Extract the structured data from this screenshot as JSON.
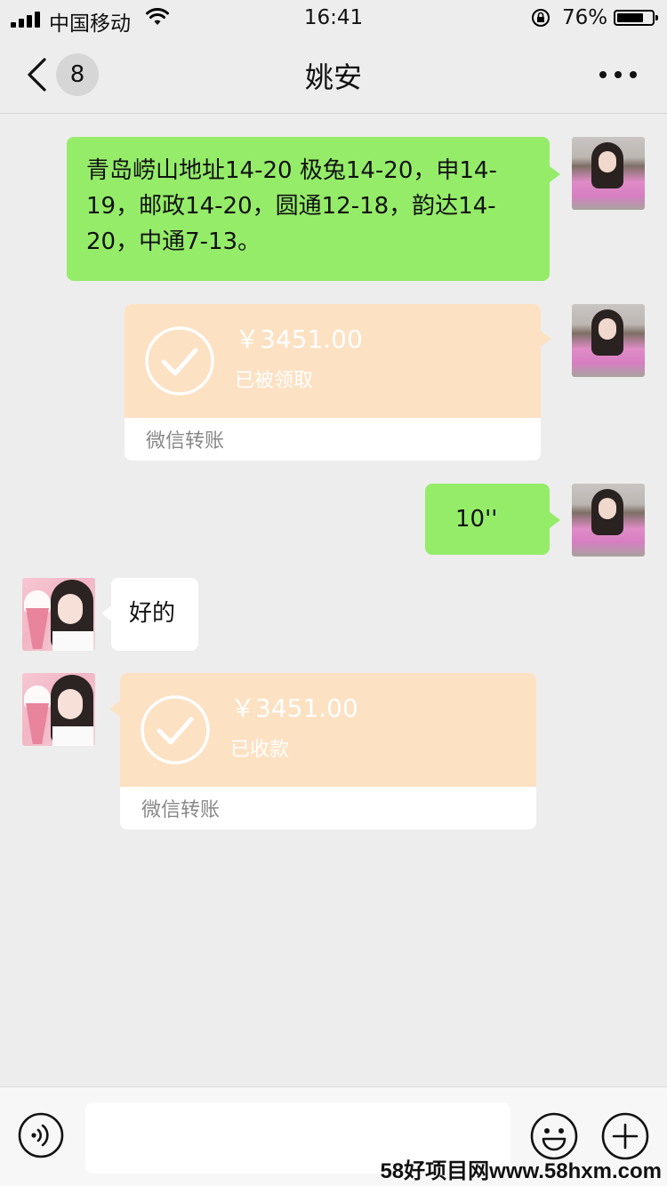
{
  "status_bar": {
    "carrier": "中国移动",
    "time": "16:41",
    "battery_percent": "76%",
    "battery_level": 0.76
  },
  "nav": {
    "unread_count": "8",
    "title": "姚安",
    "back_icon": "chevron-left-icon",
    "more_icon": "more-dots-icon"
  },
  "messages": [
    {
      "side": "self",
      "type": "text",
      "text": "青岛崂山地址14-20 极兔14-20，申14-19，邮政14-20，圆通12-18，韵达14-20，中通7-13。"
    },
    {
      "side": "self",
      "type": "transfer",
      "amount": "￥3451.00",
      "status": "已被领取",
      "label": "微信转账"
    },
    {
      "side": "self",
      "type": "text",
      "text": "10''"
    },
    {
      "side": "other",
      "type": "text",
      "text": "好的"
    },
    {
      "side": "other",
      "type": "transfer",
      "amount": "￥3451.00",
      "status": "已收款",
      "label": "微信转账"
    }
  ],
  "input_bar": {
    "voice_icon": "voice-icon",
    "emoji_icon": "emoji-icon",
    "plus_icon": "plus-icon",
    "text_value": ""
  },
  "watermark": "58好项目网www.58hxm.com",
  "colors": {
    "background": "#ededed",
    "self_bubble": "#95ec69",
    "other_bubble": "#ffffff",
    "transfer_card": "#fde1c3"
  }
}
